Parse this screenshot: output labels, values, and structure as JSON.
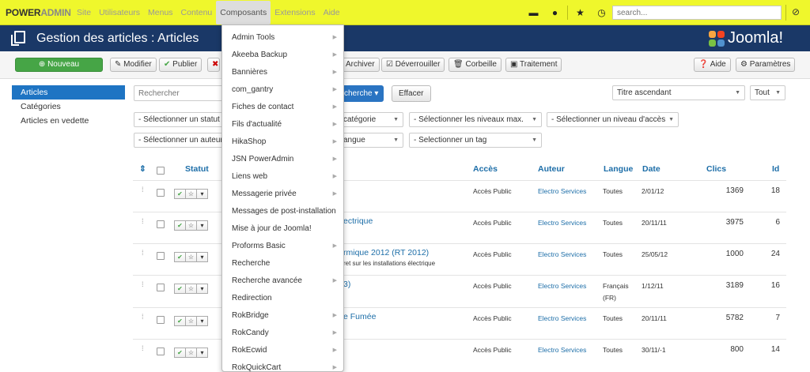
{
  "brand": {
    "part1": "POWER",
    "part2": "ADMIN"
  },
  "topnav": [
    "Site",
    "Utilisateurs",
    "Menus",
    "Contenu",
    "Composants",
    "Extensions",
    "Aide"
  ],
  "topnav_active": "Composants",
  "top_icons": [
    "monitor-icon",
    "user-icon",
    "star-icon",
    "clock-icon"
  ],
  "search": {
    "placeholder": "search..."
  },
  "header": {
    "title": "Gestion des articles : Articles",
    "logo": "Joomla!"
  },
  "toolbar": {
    "new": "Nouveau",
    "edit": "Modifier",
    "publish": "Publier",
    "archive": "Archiver",
    "unlock": "Déverrouiller",
    "trash": "Corbeille",
    "batch": "Traitement",
    "help": "Aide",
    "options": "Paramètres"
  },
  "sidebar": [
    "Articles",
    "Catégories",
    "Articles en vedette"
  ],
  "filters": {
    "search_placeholder": "Rechercher",
    "search_btn": "cherche",
    "clear_btn": "Effacer",
    "sort": "Titre ascendant",
    "limit": "Tout",
    "status": "- Sélectionner un statut",
    "category": "catégorie",
    "max_levels": "- Sélectionner les niveaux max.",
    "access": "- Sélectionner un niveau d'accès",
    "author": "- Sélectionner un auteur",
    "language": "angue",
    "tag": "- Selectionner un tag"
  },
  "table": {
    "headers": {
      "status": "Statut",
      "access": "Accès",
      "author": "Auteur",
      "language": "Langue",
      "date": "Date",
      "hits": "Clics",
      "id": "Id"
    },
    "rows": [
      {
        "title": "",
        "sub": "",
        "access": "Accès Public",
        "author": "Electro Services",
        "language": "Toutes",
        "date": "2/01/12",
        "hits": "1369",
        "id": "18"
      },
      {
        "title": "ectrique",
        "sub": "",
        "access": "Accès Public",
        "author": "Electro Services",
        "language": "Toutes",
        "date": "20/11/11",
        "hits": "3975",
        "id": "6"
      },
      {
        "title": "rmique 2012 (RT 2012)",
        "sub": "ret sur les installations électrique",
        "access": "Accès Public",
        "author": "Electro Services",
        "language": "Toutes",
        "date": "25/05/12",
        "hits": "1000",
        "id": "24"
      },
      {
        "title": "3)",
        "sub": "",
        "access": "Accès Public",
        "author": "Electro Services",
        "language": "Français",
        "language2": "(FR)",
        "date": "1/12/11",
        "hits": "3189",
        "id": "16"
      },
      {
        "title": "e Fumée",
        "sub": "",
        "access": "Accès Public",
        "author": "Electro Services",
        "language": "Toutes",
        "date": "20/11/11",
        "hits": "5782",
        "id": "7"
      },
      {
        "title": "",
        "sub": "",
        "access": "Accès Public",
        "author": "Electro Services",
        "language": "Toutes",
        "date": "30/11/-1",
        "hits": "800",
        "id": "14"
      }
    ]
  },
  "dropdown": [
    {
      "label": "Admin Tools",
      "sub": true
    },
    {
      "label": "Akeeba Backup",
      "sub": true
    },
    {
      "label": "Bannières",
      "sub": true
    },
    {
      "label": "com_gantry",
      "sub": true
    },
    {
      "label": "Fiches de contact",
      "sub": true
    },
    {
      "label": "Fils d'actualité",
      "sub": true
    },
    {
      "label": "HikaShop",
      "sub": true
    },
    {
      "label": "JSN PowerAdmin",
      "sub": true
    },
    {
      "label": "Liens web",
      "sub": true
    },
    {
      "label": "Messagerie privée",
      "sub": true
    },
    {
      "label": "Messages de post-installation",
      "sub": false
    },
    {
      "label": "Mise à jour de Joomla!",
      "sub": false
    },
    {
      "label": "Proforms Basic",
      "sub": true
    },
    {
      "label": "Recherche",
      "sub": false
    },
    {
      "label": "Recherche avancée",
      "sub": true
    },
    {
      "label": "Redirection",
      "sub": false
    },
    {
      "label": "RokBridge",
      "sub": true
    },
    {
      "label": "RokCandy",
      "sub": true
    },
    {
      "label": "RokEcwid",
      "sub": true
    },
    {
      "label": "RokQuickCart",
      "sub": true
    }
  ],
  "colors": {
    "topbar": "#eff72c",
    "header": "#1a3867",
    "accent": "#1e74c3",
    "green": "#46a546"
  }
}
